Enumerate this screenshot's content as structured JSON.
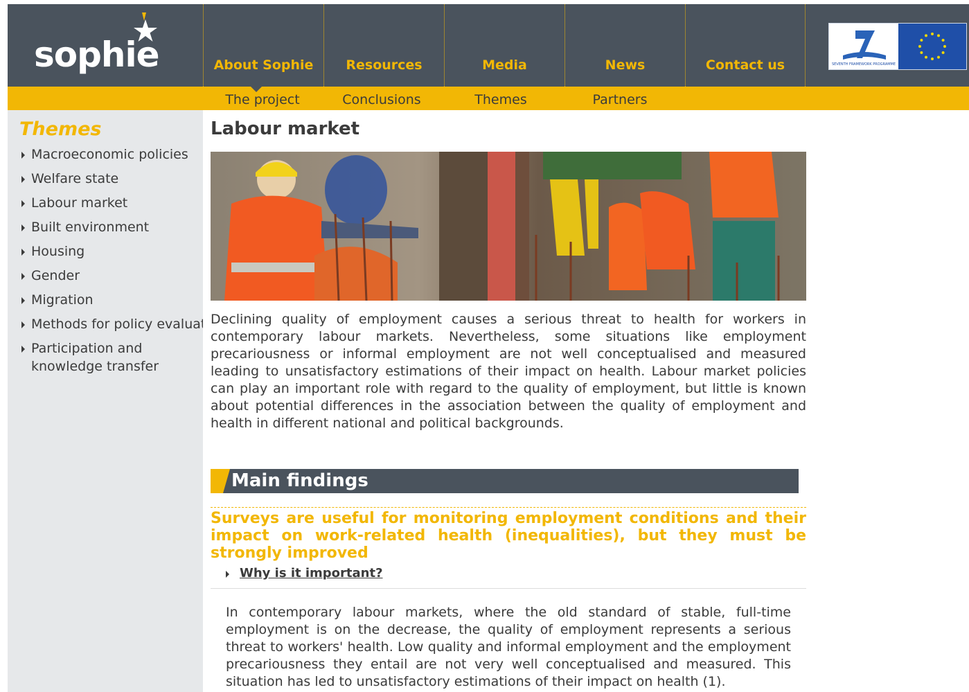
{
  "logo": {
    "text": "sophie"
  },
  "nav": [
    {
      "label": "About Sophie"
    },
    {
      "label": "Resources"
    },
    {
      "label": "Media"
    },
    {
      "label": "News"
    },
    {
      "label": "Contact us"
    }
  ],
  "subnav": [
    {
      "label": "The project"
    },
    {
      "label": "Conclusions"
    },
    {
      "label": "Themes"
    },
    {
      "label": "Partners"
    }
  ],
  "flags": {
    "fp7_text": "SEVENTH FRAMEWORK PROGRAMME"
  },
  "sidebar": {
    "title": "Themes",
    "items": [
      {
        "label": "Macroeconomic policies"
      },
      {
        "label": "Welfare state"
      },
      {
        "label": "Labour market"
      },
      {
        "label": "Built environment"
      },
      {
        "label": "Housing"
      },
      {
        "label": "Gender"
      },
      {
        "label": "Migration"
      },
      {
        "label": "Methods for policy evaluat"
      },
      {
        "label": "Participation and knowledge transfer"
      }
    ]
  },
  "main": {
    "title": "Labour market",
    "intro": "Declining quality of employment causes a serious threat to health for workers in contemporary labour markets. Nevertheless, some situations like employment precariousness or informal employment are not well conceptualised and measured leading to unsatisfactory estimations of their impact on health. Labour market policies can play an important role with regard to the quality of employment, but little is known about potential differences in the association between the quality of employment and health in different national and political backgrounds.",
    "findings_title": "Main findings",
    "finding_heading": "Surveys are useful for monitoring employment conditions and their impact on work-related health (inequalities), but they must be strongly improved",
    "why_link": "Why is it important?",
    "body": "In contemporary labour markets, where the old standard of stable, full-time employment is on the decrease, the quality of employment represents a serious threat to workers' health. Low quality and informal employment and the employment precariousness they entail are not very well conceptualised and measured. This situation has led to unsatisfactory estimations of their impact on health (1)."
  },
  "colors": {
    "accent": "#f2b705",
    "dark": "#4a535d",
    "sidebar_bg": "#e6e8ea"
  }
}
